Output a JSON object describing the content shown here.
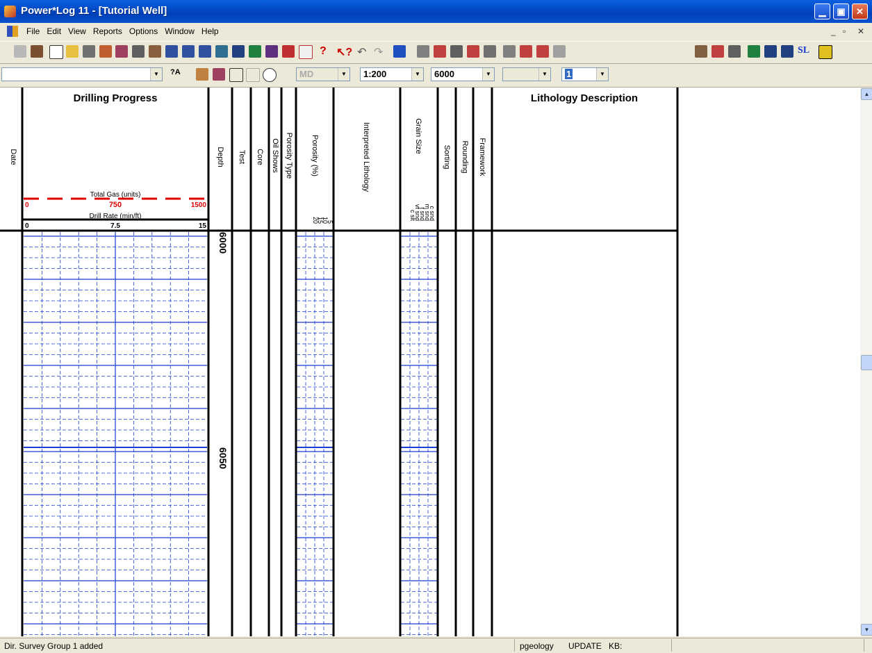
{
  "window": {
    "title": "Power*Log 11 - [Tutorial Well]"
  },
  "menu": {
    "items": [
      "File",
      "Edit",
      "View",
      "Reports",
      "Options",
      "Window",
      "Help"
    ]
  },
  "toolbar2": {
    "track_combo": "",
    "depth_mode": "MD",
    "scale": "1:200",
    "depth": "6000",
    "blank_combo": "",
    "page": "1"
  },
  "log": {
    "drilling_progress": "Drilling Progress",
    "lithology_description": "Lithology Description",
    "columns": {
      "date": "Date",
      "depth": "Depth",
      "test": "Test",
      "core": "Core",
      "oil_shows": "Oil Shows",
      "porosity_type": "Porosity Type",
      "porosity_pct": "Porosity (%)",
      "interpreted_lithology": "Interpreted Lithology",
      "grain_size": "Grain Size",
      "sorting": "Sorting",
      "rounding": "Rounding",
      "framework": "Framework"
    },
    "total_gas": "Total Gas (units)",
    "gas_scale": [
      "0",
      "750",
      "1500"
    ],
    "drill_rate": "Drill Rate (min/ft)",
    "rate_scale": [
      "0",
      "7.5",
      "15"
    ],
    "porosity_scale": [
      "5",
      "10",
      "15",
      "20"
    ],
    "grain_scale": [
      "c snd",
      "m snd",
      "f snd",
      "vf snd",
      "c slt"
    ],
    "depth_labels": [
      "6000",
      "6050"
    ],
    "colors": {
      "grid": "#1a3ccf",
      "gas": "#e00000"
    }
  },
  "status": {
    "message": "Dir. Survey Group 1 added",
    "user": "pgeology",
    "mode": "UPDATE",
    "kb": "KB:"
  }
}
